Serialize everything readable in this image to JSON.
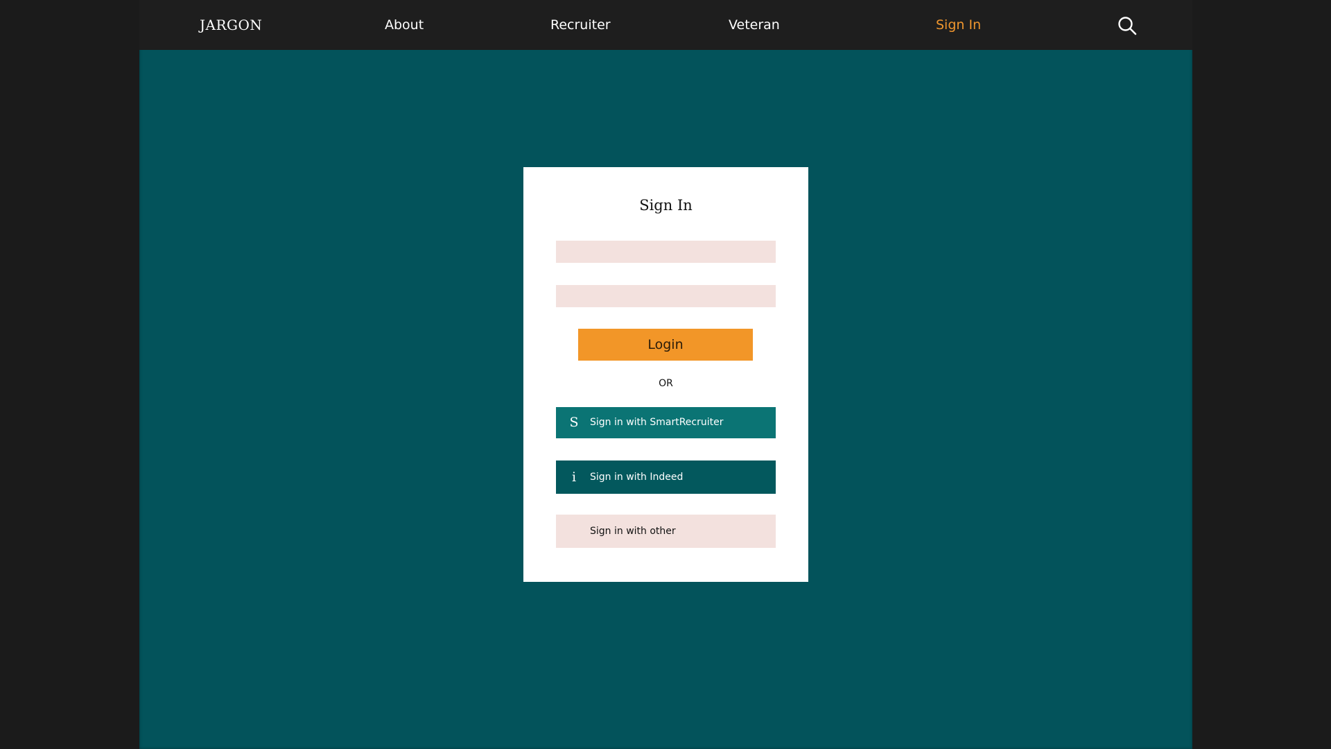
{
  "nav": {
    "brand": "JARGON",
    "about": "About",
    "recruiter": "Recruiter",
    "veteran": "Veteran",
    "sign_in": "Sign In",
    "search_icon": "search-icon"
  },
  "login": {
    "title": "Sign In",
    "username_value": "",
    "password_value": "",
    "login_label": "Login",
    "or_label": "OR",
    "sso_options": [
      {
        "icon_text": "S",
        "icon": "smartrecruiter-icon",
        "label": "Sign in with SmartRecruiter"
      },
      {
        "icon_text": "i",
        "icon": "indeed-icon",
        "label": "Sign in with Indeed"
      },
      {
        "icon_text": "",
        "label": "Sign in with other"
      }
    ]
  },
  "colors": {
    "page_background": "#1b1b1b",
    "content_background": "#03535b",
    "navbar": "#1e1e1e",
    "accent": "#f29628",
    "active_nav": "#f0962e",
    "field_background": "#f3e1de",
    "smartrecruiter_button": "#0b7474",
    "indeed_button": "#03585d"
  }
}
